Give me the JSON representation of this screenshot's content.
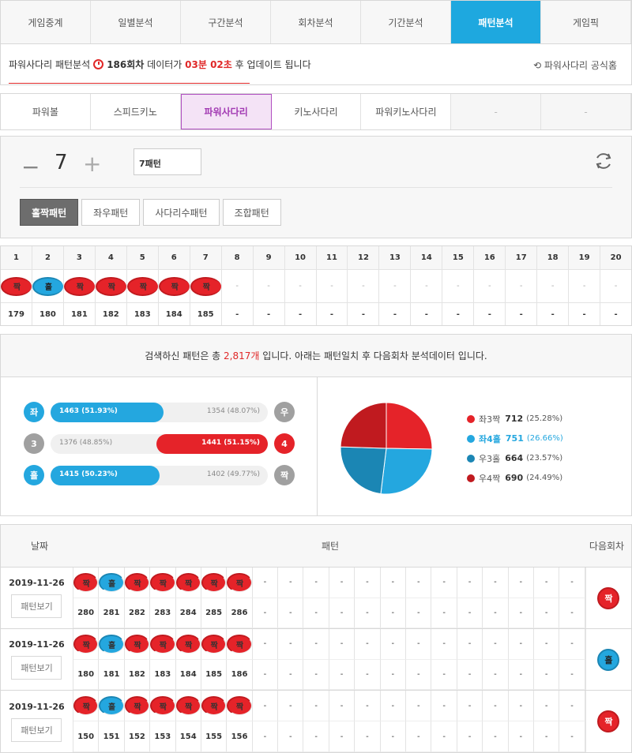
{
  "top_tabs": [
    "게임중계",
    "일별분석",
    "구간분석",
    "회차분석",
    "기간분석",
    "패턴분석",
    "게임픽"
  ],
  "top_active": 5,
  "notice": {
    "prefix": "파워사다리 패턴분석",
    "round": "186회차",
    "mid": "데이터가",
    "time": "03분 02초",
    "suffix": "후 업데이트 됩니다",
    "official": "파워사다리 공식홈"
  },
  "sub_tabs": [
    "파워볼",
    "스피드키노",
    "파워사다리",
    "키노사다리",
    "파워키노사다리",
    "-",
    "-"
  ],
  "sub_active": 2,
  "control": {
    "minus": "−",
    "value": "7",
    "plus": "+",
    "input_value": "7패턴"
  },
  "pattern_tabs": [
    "홀짝패턴",
    "좌우패턴",
    "사다리수패턴",
    "조합패턴"
  ],
  "pattern_active": 0,
  "seq": {
    "headers": [
      "1",
      "2",
      "3",
      "4",
      "5",
      "6",
      "7",
      "8",
      "9",
      "10",
      "11",
      "12",
      "13",
      "14",
      "15",
      "16",
      "17",
      "18",
      "19",
      "20"
    ],
    "balls": [
      {
        "t": "짝",
        "c": "red"
      },
      {
        "t": "홀",
        "c": "blue"
      },
      {
        "t": "짝",
        "c": "red"
      },
      {
        "t": "짝",
        "c": "red"
      },
      {
        "t": "짝",
        "c": "red"
      },
      {
        "t": "짝",
        "c": "red"
      },
      {
        "t": "짝",
        "c": "red"
      },
      {
        "t": "-",
        "c": ""
      },
      {
        "t": "-",
        "c": ""
      },
      {
        "t": "-",
        "c": ""
      },
      {
        "t": "-",
        "c": ""
      },
      {
        "t": "-",
        "c": ""
      },
      {
        "t": "-",
        "c": ""
      },
      {
        "t": "-",
        "c": ""
      },
      {
        "t": "-",
        "c": ""
      },
      {
        "t": "-",
        "c": ""
      },
      {
        "t": "-",
        "c": ""
      },
      {
        "t": "-",
        "c": ""
      },
      {
        "t": "-",
        "c": ""
      },
      {
        "t": "-",
        "c": ""
      }
    ],
    "rounds": [
      "179",
      "180",
      "181",
      "182",
      "183",
      "184",
      "185",
      "-",
      "-",
      "-",
      "-",
      "-",
      "-",
      "-",
      "-",
      "-",
      "-",
      "-",
      "-",
      "-"
    ]
  },
  "summary": {
    "a": "검색하신 패턴은 총",
    "count": "2,817개",
    "b": "입니다. 아래는 패턴일치 후 다음회차 분석데이터 입니다."
  },
  "bars": [
    {
      "left_ball": "좌",
      "left_color": "#24a7df",
      "left_text": "1463 (51.93%)",
      "left_pct": 51.93,
      "right_text": "1354 (48.07%)",
      "right_ball": "우",
      "right_color": "#a0a0a0",
      "side": "left",
      "fill_color": "#24a7df"
    },
    {
      "left_ball": "3",
      "left_color": "#a0a0a0",
      "left_text": "1376 (48.85%)",
      "left_pct": 51.15,
      "right_text": "1441 (51.15%)",
      "right_ball": "4",
      "right_color": "#e52329",
      "side": "right",
      "fill_color": "#e52329"
    },
    {
      "left_ball": "홀",
      "left_color": "#24a7df",
      "left_text": "1415 (50.23%)",
      "left_pct": 50.23,
      "right_text": "1402 (49.77%)",
      "right_ball": "짝",
      "right_color": "#a0a0a0",
      "side": "left",
      "fill_color": "#24a7df"
    }
  ],
  "pie": [
    {
      "label": "좌3짝",
      "value": 712,
      "pct": "(25.28%)",
      "color": "#e52329",
      "hl": false
    },
    {
      "label": "좌4홀",
      "value": 751,
      "pct": "(26.66%)",
      "color": "#24a7df",
      "hl": true
    },
    {
      "label": "우3홀",
      "value": 664,
      "pct": "(23.57%)",
      "color": "#1b86b4",
      "hl": false
    },
    {
      "label": "우4짝",
      "value": 690,
      "pct": "(24.49%)",
      "color": "#c01a1f",
      "hl": false
    }
  ],
  "results_header": {
    "date": "날짜",
    "pattern": "패턴",
    "next": "다음회차"
  },
  "results": [
    {
      "date": "2019-11-26",
      "btn": "패턴보기",
      "balls": [
        "짝",
        "홀",
        "짝",
        "짝",
        "짝",
        "짝",
        "짝"
      ],
      "colors": [
        "red",
        "blue",
        "red",
        "red",
        "red",
        "red",
        "red"
      ],
      "rounds": [
        "280",
        "281",
        "282",
        "283",
        "284",
        "285",
        "286"
      ],
      "next": "짝",
      "next_color": "red"
    },
    {
      "date": "2019-11-26",
      "btn": "패턴보기",
      "balls": [
        "짝",
        "홀",
        "짝",
        "짝",
        "짝",
        "짝",
        "짝"
      ],
      "colors": [
        "red",
        "blue",
        "red",
        "red",
        "red",
        "red",
        "red"
      ],
      "rounds": [
        "180",
        "181",
        "182",
        "183",
        "184",
        "185",
        "186"
      ],
      "next": "홀",
      "next_color": "blue"
    },
    {
      "date": "2019-11-26",
      "btn": "패턴보기",
      "balls": [
        "짝",
        "홀",
        "짝",
        "짝",
        "짝",
        "짝",
        "짝"
      ],
      "colors": [
        "red",
        "blue",
        "red",
        "red",
        "red",
        "red",
        "red"
      ],
      "rounds": [
        "150",
        "151",
        "152",
        "153",
        "154",
        "155",
        "156"
      ],
      "next": "짝",
      "next_color": "red"
    }
  ],
  "empty_cell": "-"
}
